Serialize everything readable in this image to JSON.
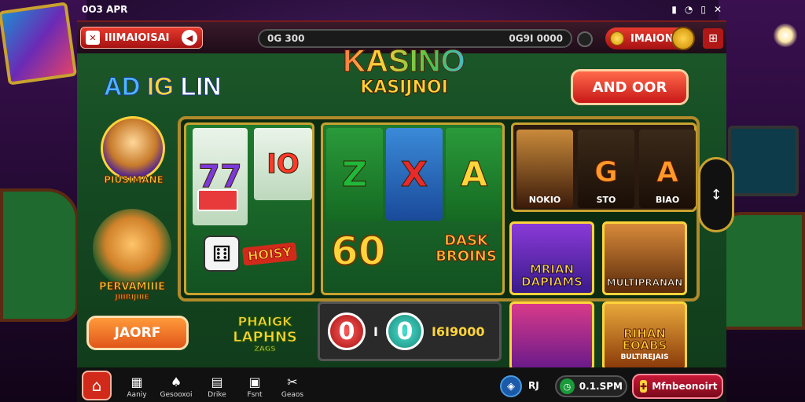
{
  "status_bar": {
    "time": "0O3 APR",
    "icons": [
      "signal-icon",
      "wifi-icon",
      "battery-icon",
      "close-icon"
    ]
  },
  "top_bar": {
    "logo_label": "IIIMAIOISAI",
    "balance_left": "0G 300",
    "balance_right": "0G9I 0000",
    "menu_label": "IMAION"
  },
  "promo": {
    "word1": "AD",
    "word2": "IG",
    "word3": "LIN"
  },
  "brand": {
    "main": "KASINO",
    "sub": "KASIJNOI"
  },
  "cta_top_label": "AND OOR",
  "left_column": {
    "mascot1_label": "PIUSIMANE",
    "mascot2_label": "PERVAMIIIE",
    "mascot2_sub": "JIIIRIJIIIE",
    "cta_label": "JAORF",
    "promo_line1": "PHAIGK",
    "promo_line2": "LAPHNS",
    "promo_line3": "ZAGS"
  },
  "slots": {
    "left_reel_a": "77",
    "left_reel_b": "IO",
    "dice_label": "HOISY",
    "reel_c": "Z",
    "reel_d": "X",
    "reel_e": "A",
    "mid_number": "60",
    "mid_label_1": "DASK",
    "mid_label_2": "BROINS",
    "portrait_1": "NOKIO",
    "portrait_2_glyph": "G",
    "portrait_2": "STO",
    "portrait_3_glyph": "A",
    "portrait_3": "BIAO"
  },
  "tiles": {
    "tile1_line1": "MRIAN",
    "tile1_line2": "DAPIAMS",
    "tile2_label": "MULTIPRANAN",
    "tile3_label": "",
    "tile4_line1": "RIHAN",
    "tile4_line2": "EOABS",
    "tile4_sub": "BULTIREJAIS"
  },
  "counter": {
    "left": "0",
    "sep": "I",
    "right": "0",
    "value": "I6I9000"
  },
  "bottom_nav": {
    "items": [
      {
        "label": "Aaniy",
        "icon": "slots-icon"
      },
      {
        "label": "Gesooxoi",
        "icon": "poker-icon"
      },
      {
        "label": "Drike",
        "icon": "cards-icon"
      },
      {
        "label": "Fsnt",
        "icon": "table-icon"
      },
      {
        "label": "Geaos",
        "icon": "tools-icon"
      }
    ],
    "rj_label": "RJ",
    "time_label": "0.1.SPM",
    "account_label": "Mfnbeonoirt"
  }
}
